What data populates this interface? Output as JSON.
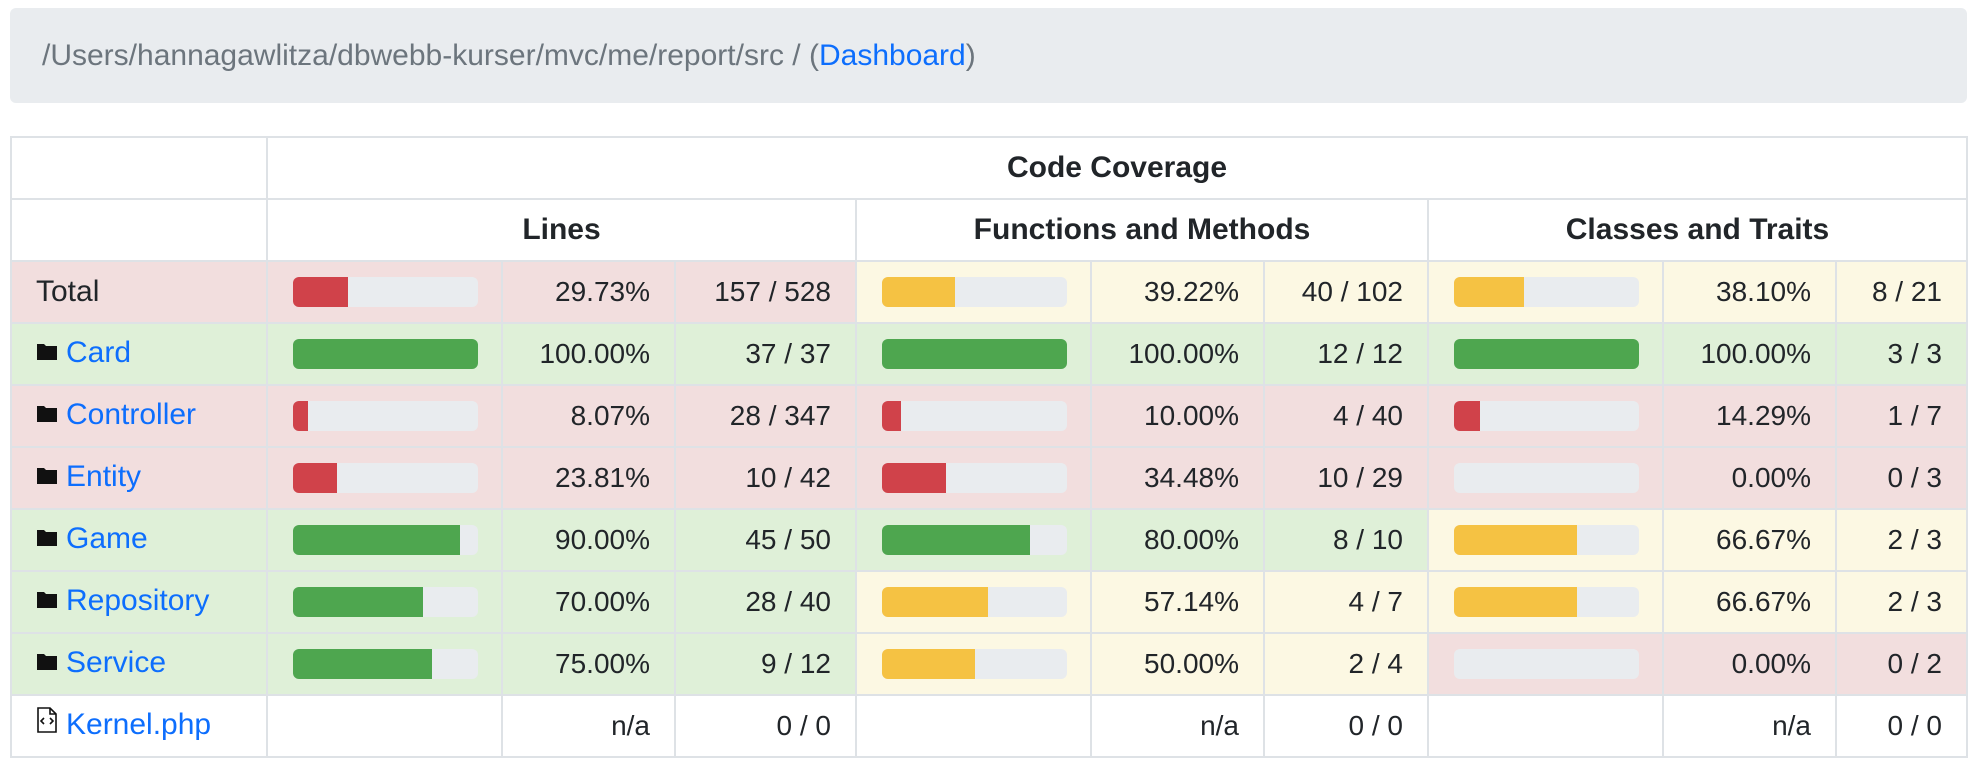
{
  "breadcrumb": {
    "path": "/Users/hannagawlitza/dbwebb-kurser/mvc/me/report/src",
    "separator": " / ",
    "open_paren": " (",
    "dashboard_link": "Dashboard",
    "close_paren": ")"
  },
  "table": {
    "header": "Code Coverage",
    "groups": [
      "Lines",
      "Functions and Methods",
      "Classes and Traits"
    ],
    "rows": [
      {
        "name": "Total",
        "type": "total",
        "lines": {
          "pct": 29.73,
          "pct_text": "29.73%",
          "count": "157 / 528",
          "level": "danger"
        },
        "functions": {
          "pct": 39.22,
          "pct_text": "39.22%",
          "count": "40 / 102",
          "level": "warning"
        },
        "classes": {
          "pct": 38.1,
          "pct_text": "38.10%",
          "count": "8 / 21",
          "level": "warning"
        }
      },
      {
        "name": "Card",
        "type": "folder",
        "lines": {
          "pct": 100,
          "pct_text": "100.00%",
          "count": "37 / 37",
          "level": "success"
        },
        "functions": {
          "pct": 100,
          "pct_text": "100.00%",
          "count": "12 / 12",
          "level": "success"
        },
        "classes": {
          "pct": 100,
          "pct_text": "100.00%",
          "count": "3 / 3",
          "level": "success"
        }
      },
      {
        "name": "Controller",
        "type": "folder",
        "lines": {
          "pct": 8.07,
          "pct_text": "8.07%",
          "count": "28 / 347",
          "level": "danger"
        },
        "functions": {
          "pct": 10.0,
          "pct_text": "10.00%",
          "count": "4 / 40",
          "level": "danger"
        },
        "classes": {
          "pct": 14.29,
          "pct_text": "14.29%",
          "count": "1 / 7",
          "level": "danger"
        }
      },
      {
        "name": "Entity",
        "type": "folder",
        "lines": {
          "pct": 23.81,
          "pct_text": "23.81%",
          "count": "10 / 42",
          "level": "danger"
        },
        "functions": {
          "pct": 34.48,
          "pct_text": "34.48%",
          "count": "10 / 29",
          "level": "danger"
        },
        "classes": {
          "pct": 0,
          "pct_text": "0.00%",
          "count": "0 / 3",
          "level": "danger"
        }
      },
      {
        "name": "Game",
        "type": "folder",
        "lines": {
          "pct": 90.0,
          "pct_text": "90.00%",
          "count": "45 / 50",
          "level": "success"
        },
        "functions": {
          "pct": 80.0,
          "pct_text": "80.00%",
          "count": "8 / 10",
          "level": "success"
        },
        "classes": {
          "pct": 66.67,
          "pct_text": "66.67%",
          "count": "2 / 3",
          "level": "warning"
        }
      },
      {
        "name": "Repository",
        "type": "folder",
        "lines": {
          "pct": 70.0,
          "pct_text": "70.00%",
          "count": "28 / 40",
          "level": "success"
        },
        "functions": {
          "pct": 57.14,
          "pct_text": "57.14%",
          "count": "4 / 7",
          "level": "warning"
        },
        "classes": {
          "pct": 66.67,
          "pct_text": "66.67%",
          "count": "2 / 3",
          "level": "warning"
        }
      },
      {
        "name": "Service",
        "type": "folder",
        "lines": {
          "pct": 75.0,
          "pct_text": "75.00%",
          "count": "9 / 12",
          "level": "success"
        },
        "functions": {
          "pct": 50.0,
          "pct_text": "50.00%",
          "count": "2 / 4",
          "level": "warning"
        },
        "classes": {
          "pct": 0,
          "pct_text": "0.00%",
          "count": "0 / 2",
          "level": "danger"
        }
      },
      {
        "name": "Kernel.php",
        "type": "file",
        "lines": {
          "pct": null,
          "pct_text": "n/a",
          "count": "0 / 0",
          "level": "none"
        },
        "functions": {
          "pct": null,
          "pct_text": "n/a",
          "count": "0 / 0",
          "level": "none"
        },
        "classes": {
          "pct": null,
          "pct_text": "n/a",
          "count": "0 / 0",
          "level": "none"
        }
      }
    ]
  },
  "colors": {
    "danger": "#d0424a",
    "warning": "#f5c243",
    "success": "#4ea64f",
    "link": "#0d6efd"
  }
}
